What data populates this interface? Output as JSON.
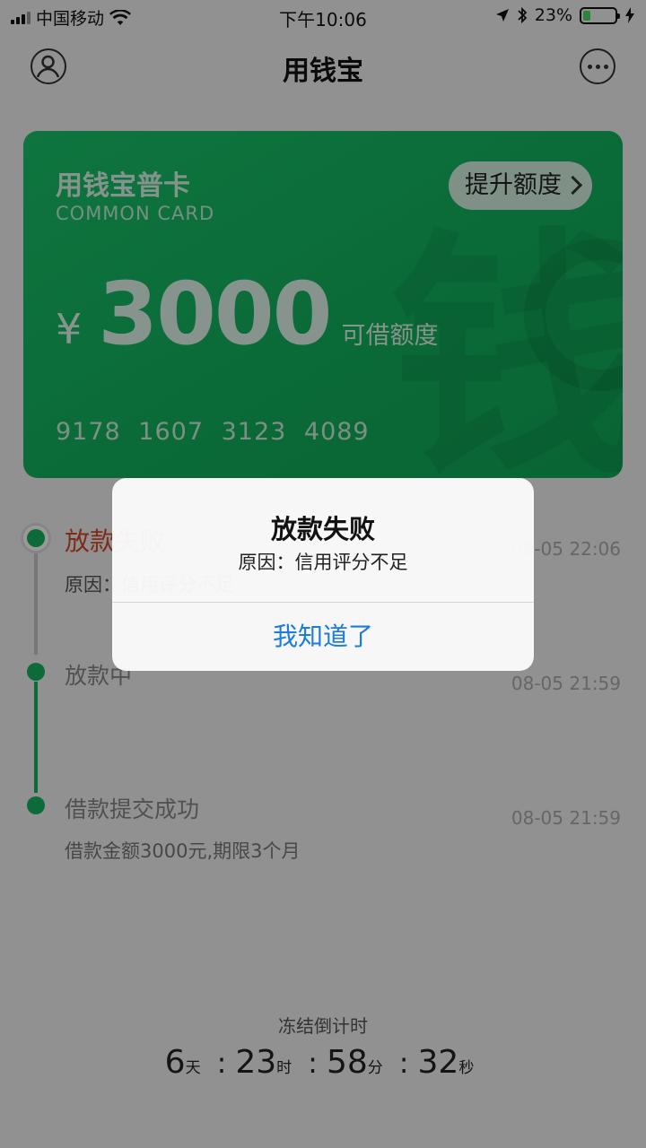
{
  "status_bar": {
    "carrier": "中国移动",
    "time": "下午10:06",
    "battery_percent": "23%",
    "battery_level": 0.23
  },
  "nav": {
    "title": "用钱宝",
    "left_icon": "user-icon",
    "right_icon": "more-icon"
  },
  "card": {
    "name": "用钱宝普卡",
    "subtitle": "COMMON CARD",
    "raise_label": "提升额度",
    "currency": "¥",
    "amount": "3000",
    "amount_label": "可借额度",
    "number": "9178 1607 3123 4089",
    "watermark": "钱"
  },
  "timeline": [
    {
      "title": "放款失败",
      "desc": "原因：信用评分不足",
      "time": "08-05 22:06",
      "status": "fail"
    },
    {
      "title": "放款中",
      "desc": "",
      "time": "08-05 21:59",
      "status": "done"
    },
    {
      "title": "借款提交成功",
      "desc": "借款金额3000元,期限3个月",
      "time": "08-05 21:59",
      "status": "done"
    }
  ],
  "countdown": {
    "label": "冻结倒计时",
    "days": "6",
    "days_unit": "天",
    "hours": "23",
    "hours_unit": "时",
    "minutes": "58",
    "minutes_unit": "分",
    "seconds": "32",
    "seconds_unit": "秒",
    "separator": ":"
  },
  "alert": {
    "title": "放款失败",
    "message": "原因：信用评分不足",
    "button": "我知道了"
  },
  "colors": {
    "brand_green": "#17b25f",
    "fail_red": "#d24a2a",
    "link_blue": "#1a7be3"
  }
}
